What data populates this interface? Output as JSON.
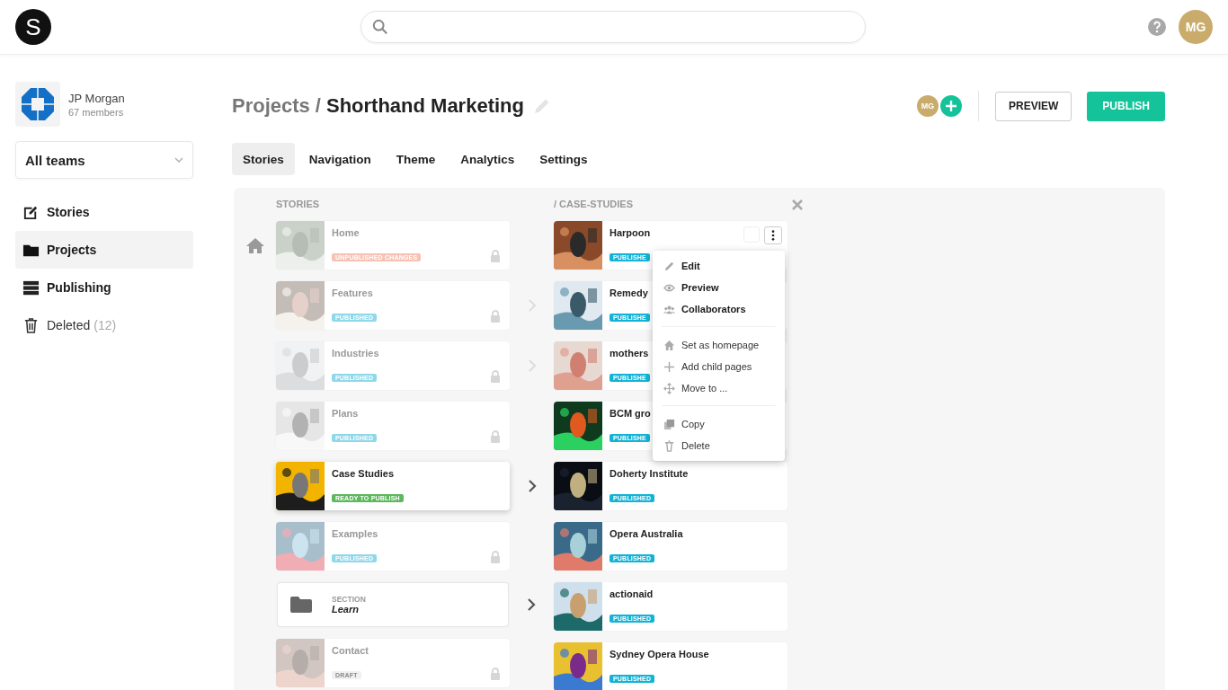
{
  "topbar": {
    "logo": "S",
    "avatar": "MG"
  },
  "sidebar": {
    "org": {
      "name": "JP Morgan",
      "members": "67 members"
    },
    "team_select": "All teams",
    "items": [
      {
        "label": "Stories",
        "selected": false,
        "bold": true
      },
      {
        "label": "Projects",
        "selected": true,
        "bold": true
      },
      {
        "label": "Publishing",
        "selected": false,
        "bold": true
      },
      {
        "label": "Deleted",
        "count": "(12)",
        "selected": false,
        "bold": false
      }
    ]
  },
  "header": {
    "breadcrumb_parent": "Projects",
    "separator": "/",
    "title": "Shorthand Marketing",
    "collaborator": "MG",
    "preview_button": "PREVIEW",
    "publish_button": "PUBLISH"
  },
  "tabs": [
    {
      "label": "Stories",
      "selected": true
    },
    {
      "label": "Navigation",
      "selected": false
    },
    {
      "label": "Theme",
      "selected": false
    },
    {
      "label": "Analytics",
      "selected": false
    },
    {
      "label": "Settings",
      "selected": false
    }
  ],
  "stories": {
    "heading": "STORIES",
    "items": [
      {
        "kind": "story",
        "title": "Home",
        "status": "UNPUBLISHED CHANGES",
        "color": "#f7c2b4",
        "homepage": true,
        "locked": true,
        "selected": false,
        "has_children": false
      },
      {
        "kind": "story",
        "title": "Features",
        "status": "PUBLISHED",
        "color": "#8fd8ea",
        "homepage": false,
        "locked": true,
        "selected": false,
        "has_children": true
      },
      {
        "kind": "story",
        "title": "Industries",
        "status": "PUBLISHED",
        "color": "#8fd8ea",
        "homepage": false,
        "locked": true,
        "selected": false,
        "has_children": true
      },
      {
        "kind": "story",
        "title": "Plans",
        "status": "PUBLISHED",
        "color": "#8fd8ea",
        "homepage": false,
        "locked": true,
        "selected": false,
        "has_children": false
      },
      {
        "kind": "story",
        "title": "Case Studies",
        "status": "READY TO PUBLISH",
        "color": "#5cb85c",
        "homepage": false,
        "locked": false,
        "selected": true,
        "has_children": true
      },
      {
        "kind": "story",
        "title": "Examples",
        "status": "PUBLISHED",
        "color": "#8fd8ea",
        "homepage": false,
        "locked": true,
        "selected": false,
        "has_children": false
      },
      {
        "kind": "section",
        "label": "SECTION",
        "title": "Learn",
        "homepage": false,
        "locked": false,
        "selected": false,
        "has_children": true
      },
      {
        "kind": "story",
        "title": "Contact",
        "status": "DRAFT",
        "color": "#f0f0f0",
        "homepage": false,
        "locked": true,
        "selected": false,
        "has_children": false
      }
    ]
  },
  "children": {
    "heading": "/ CASE-STUDIES",
    "items": [
      {
        "title": "Harpoon",
        "status": "PUBLISHE",
        "color": "#12b3d6",
        "actions": true
      },
      {
        "title": "Remedy",
        "status": "PUBLISHE",
        "color": "#12b3d6",
        "actions": false
      },
      {
        "title": "mothers",
        "status": "PUBLISHE",
        "color": "#12b3d6",
        "actions": false
      },
      {
        "title": "BCM gro",
        "status": "PUBLISHE",
        "color": "#12b3d6",
        "actions": false
      },
      {
        "title": "Doherty Institute",
        "status": "PUBLISHED",
        "color": "#12b3d6",
        "actions": false
      },
      {
        "title": "Opera Australia",
        "status": "PUBLISHED",
        "color": "#12b3d6",
        "actions": false
      },
      {
        "title": "actionaid",
        "status": "PUBLISHED",
        "color": "#12b3d6",
        "actions": false
      },
      {
        "title": "Sydney Opera House",
        "status": "PUBLISHED",
        "color": "#12b3d6",
        "actions": false
      }
    ]
  },
  "context_menu": {
    "groups": [
      [
        {
          "label": "Edit",
          "bold": true
        },
        {
          "label": "Preview",
          "bold": true
        },
        {
          "label": "Collaborators",
          "bold": true
        }
      ],
      [
        {
          "label": "Set as homepage",
          "bold": false
        },
        {
          "label": "Add child pages",
          "bold": false
        },
        {
          "label": "Move to ...",
          "bold": false
        }
      ],
      [
        {
          "label": "Copy",
          "bold": false
        },
        {
          "label": "Delete",
          "bold": false
        }
      ]
    ]
  }
}
